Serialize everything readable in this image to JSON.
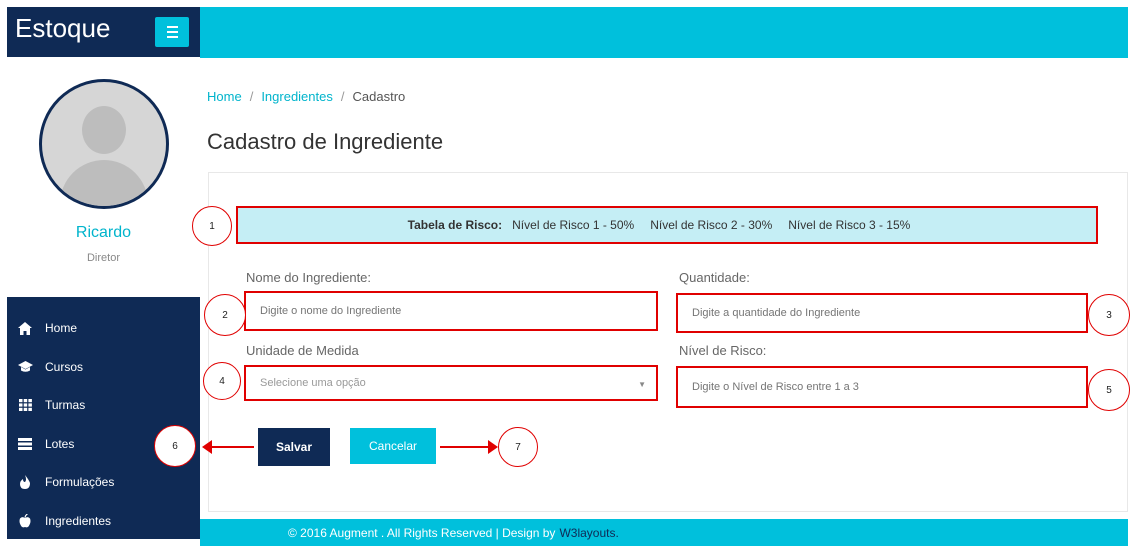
{
  "brand": {
    "title": "Estoque"
  },
  "user": {
    "name": "Ricardo",
    "role": "Diretor"
  },
  "nav": {
    "items": [
      {
        "label": "Home",
        "icon": "home-icon"
      },
      {
        "label": "Cursos",
        "icon": "graduation-cap-icon"
      },
      {
        "label": "Turmas",
        "icon": "grid-icon"
      },
      {
        "label": "Lotes",
        "icon": "layers-icon"
      },
      {
        "label": "Formulações",
        "icon": "fire-icon"
      },
      {
        "label": "Ingredientes",
        "icon": "apple-icon"
      }
    ]
  },
  "breadcrumb": {
    "home": "Home",
    "sep": "/",
    "ingredientes": "Ingredientes",
    "current": "Cadastro"
  },
  "page": {
    "title": "Cadastro de Ingrediente"
  },
  "risk_table": {
    "label": "Tabela de Risco:",
    "levels": [
      "Nível de Risco 1 - 50%",
      "Nível de Risco 2 - 30%",
      "Nível de Risco 3 - 15%"
    ]
  },
  "form": {
    "nome": {
      "label": "Nome do Ingrediente:",
      "placeholder": "Digite o nome do Ingrediente"
    },
    "quantidade": {
      "label": "Quantidade:",
      "placeholder": "Digite a quantidade do Ingrediente"
    },
    "unidade": {
      "label": "Unidade de Medida",
      "selected": "Selecione uma opção"
    },
    "risco": {
      "label": "Nível de Risco:",
      "placeholder": "Digite o Nível de Risco entre 1 a 3"
    }
  },
  "buttons": {
    "save": "Salvar",
    "cancel": "Cancelar"
  },
  "callouts": [
    "1",
    "2",
    "3",
    "4",
    "5",
    "6",
    "7"
  ],
  "footer": {
    "text": "© 2016 Augment . All Rights Reserved | Design by",
    "link": "W3layouts."
  },
  "colors": {
    "navy": "#0f2a55",
    "cyan": "#00c0dc",
    "highlight_red": "#e00000",
    "risk_bg": "#c5eef5"
  }
}
